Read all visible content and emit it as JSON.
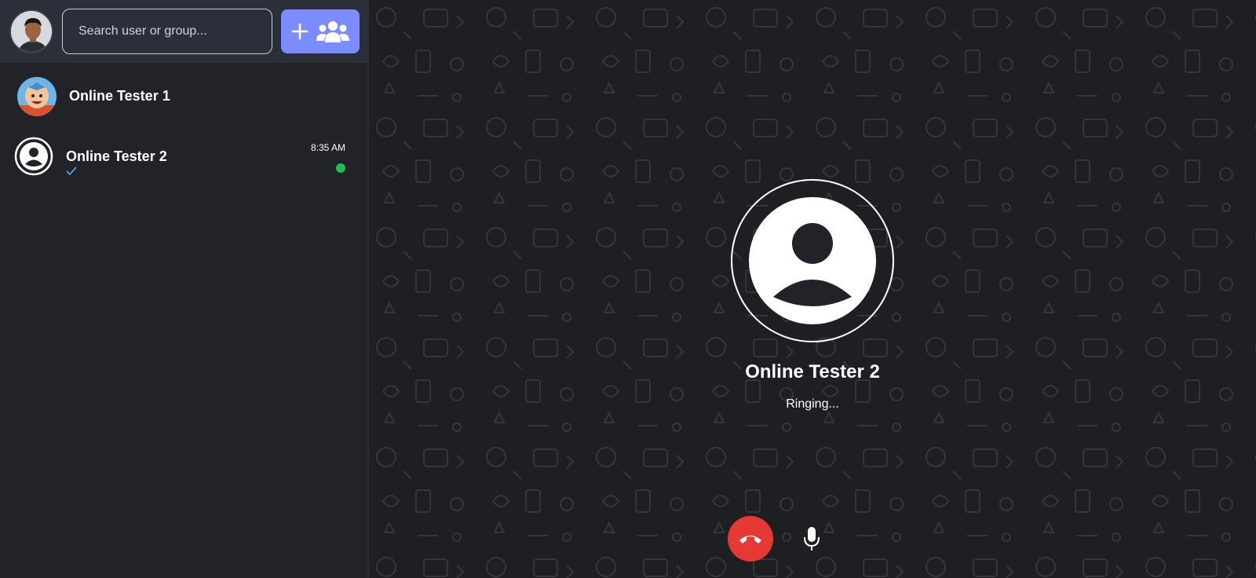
{
  "colors": {
    "accent": "#7a8cff",
    "online": "#20c04f",
    "end_call": "#e53935",
    "sidebar_bg": "#212329",
    "topbar_bg": "#2b2f3a"
  },
  "topbar": {
    "search_placeholder": "Search user or group...",
    "new_group_icons": [
      "plus-icon",
      "group-icon"
    ]
  },
  "chats": [
    {
      "name": "Online Tester 1",
      "avatar": "cartoon-avatar"
    },
    {
      "name": "Online Tester 2",
      "avatar": "default-user-icon",
      "time": "8:35 AM",
      "status_icon": "single-check-icon",
      "online": true
    }
  ],
  "call": {
    "callee_name": "Online Tester 2",
    "status": "Ringing...",
    "controls": [
      "end-call-icon",
      "microphone-icon"
    ]
  }
}
